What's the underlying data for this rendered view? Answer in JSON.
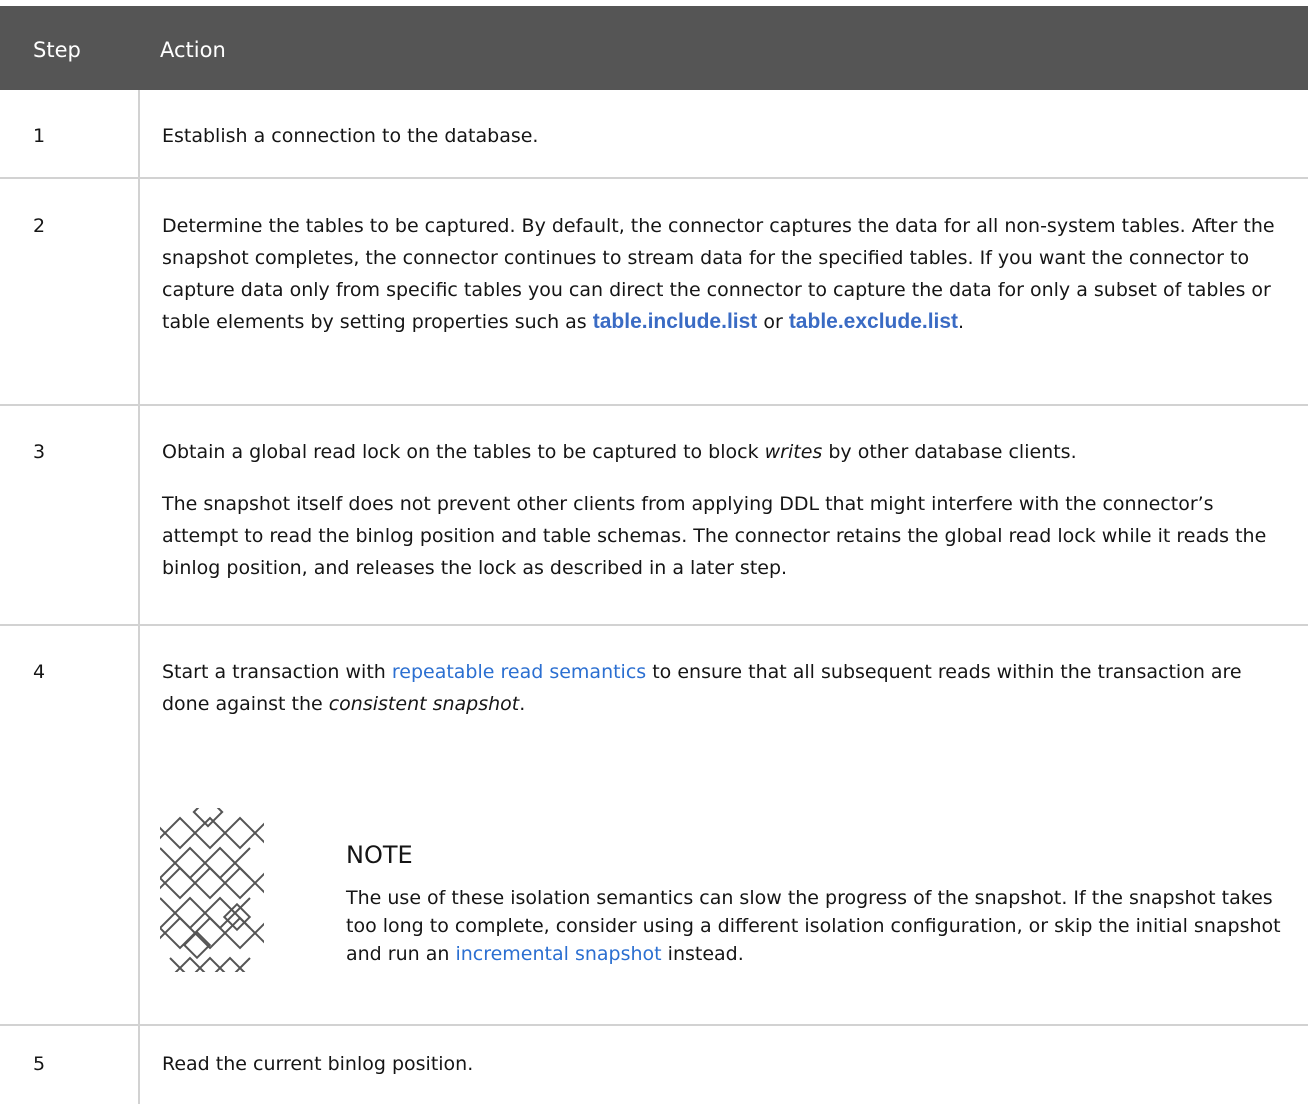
{
  "table": {
    "headers": {
      "step": "Step",
      "action": "Action"
    },
    "rows": [
      {
        "step": "1",
        "text": "Establish a connection to the database."
      },
      {
        "step": "2",
        "text_before": "Determine the tables to be captured. By default, the connector captures the data for all non-system tables. After the snapshot completes, the connector continues to stream data for the specified tables. If you want the connector to capture data only from specific tables you can direct the connector to capture the data for only a subset of tables or table elements by setting properties such as ",
        "code1": "table.include.list",
        "text_between": " or ",
        "code2": "table.exclude.list",
        "text_after": "."
      },
      {
        "step": "3",
        "p1_before": "Obtain a global read lock on the tables to be captured to block ",
        "p1_em": "writes",
        "p1_after": " by other database clients.",
        "p2": "The snapshot itself does not prevent other clients from applying DDL that might interfere with the connector’s attempt to read the binlog position and table schemas. The connector retains the global read lock while it reads the binlog position, and releases the lock as described in a later step."
      },
      {
        "step": "4",
        "text_before": "Start a transaction with ",
        "link": "repeatable read semantics",
        "text_middle": " to ensure that all subsequent reads within the transaction are done against the ",
        "em": "consistent snapshot",
        "text_after": ".",
        "note": {
          "icon": "note-icon",
          "title": "NOTE",
          "body_before": "The use of these isolation semantics can slow the progress of the snapshot. If the snapshot takes too long to complete, consider using a different isolation configuration, or skip the initial snapshot and run an ",
          "link": "incremental snapshot",
          "body_after": " instead."
        }
      },
      {
        "step": "5",
        "text": "Read the current binlog position."
      }
    ]
  },
  "colors": {
    "header_bg": "#555555",
    "header_text": "#ffffff",
    "border": "#d2d2d2",
    "link": "#2b6fd1",
    "code": "#3a6bc4"
  }
}
